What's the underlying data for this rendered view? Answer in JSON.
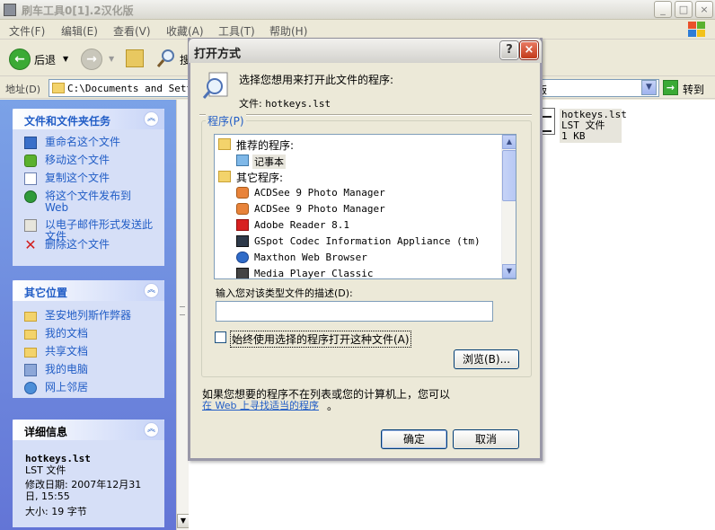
{
  "window": {
    "title": "刷车工具0[1].2汉化版",
    "minimize": "_",
    "maximize": "□",
    "close": "×"
  },
  "menubar": [
    "文件(F)",
    "编辑(E)",
    "查看(V)",
    "收藏(A)",
    "工具(T)",
    "帮助(H)"
  ],
  "toolbar": {
    "back_label": "后退",
    "search_label": "搜"
  },
  "address": {
    "label": "地址(D)",
    "value": "C:\\Documents and Setti",
    "value_tail": "版",
    "go_label": "转到"
  },
  "tasks_panel": {
    "title": "文件和文件夹任务",
    "items": [
      {
        "label": "重命名这个文件",
        "icon": "rename-icon"
      },
      {
        "label": "移动这个文件",
        "icon": "move-icon"
      },
      {
        "label": "复制这个文件",
        "icon": "copy-icon"
      },
      {
        "label": "将这个文件发布到 Web",
        "icon": "publish-web-icon"
      },
      {
        "label": "以电子邮件形式发送此文件",
        "icon": "email-icon"
      },
      {
        "label": "删除这个文件",
        "icon": "delete-icon"
      }
    ]
  },
  "places_panel": {
    "title": "其它位置",
    "items": [
      {
        "label": "圣安地列斯作弊器",
        "icon": "folder-icon"
      },
      {
        "label": "我的文档",
        "icon": "my-documents-icon"
      },
      {
        "label": "共享文档",
        "icon": "shared-documents-icon"
      },
      {
        "label": "我的电脑",
        "icon": "my-computer-icon"
      },
      {
        "label": "网上邻居",
        "icon": "network-icon"
      }
    ]
  },
  "details_panel": {
    "title": "详细信息",
    "name": "hotkeys.lst",
    "type": "LST 文件",
    "modified": "修改日期: 2007年12月31日, 15:55",
    "size": "大小: 19 字节"
  },
  "file": {
    "name": "hotkeys.lst",
    "type": "LST 文件",
    "size": "1 KB"
  },
  "dialog": {
    "title": "打开方式",
    "prompt": "选择您想用来打开此文件的程序:",
    "file_label": "文件:",
    "file_name": "hotkeys.lst",
    "programs_label": "程序(P)",
    "recommended_label": "推荐的程序:",
    "recommended": [
      "记事本"
    ],
    "other_label": "其它程序:",
    "others": [
      "ACDSee 9 Photo Manager",
      "ACDSee 9 Photo Manager",
      "Adobe Reader 8.1",
      "GSpot Codec Information Appliance (tm)",
      "Maxthon Web Browser",
      "Media Player Classic"
    ],
    "description_label": "输入您对该类型文件的描述(D):",
    "description_value": "",
    "always_use_label": "始终使用选择的程序打开这种文件(A)",
    "always_use_checked": false,
    "browse_label": "浏览(B)...",
    "hint": "如果您想要的程序不在列表或您的计算机上，您可以",
    "web_link": "在 Web 上寻找适当的程序",
    "web_link_tail": "。",
    "ok_label": "确定",
    "cancel_label": "取消",
    "help_label": "?",
    "close_label": "×"
  },
  "colors": {
    "link_blue": "#215DC6",
    "taskpane_bg": "#7BA2E7",
    "dialog_bg": "#ECE9D8",
    "close_red": "#C23A1A"
  }
}
